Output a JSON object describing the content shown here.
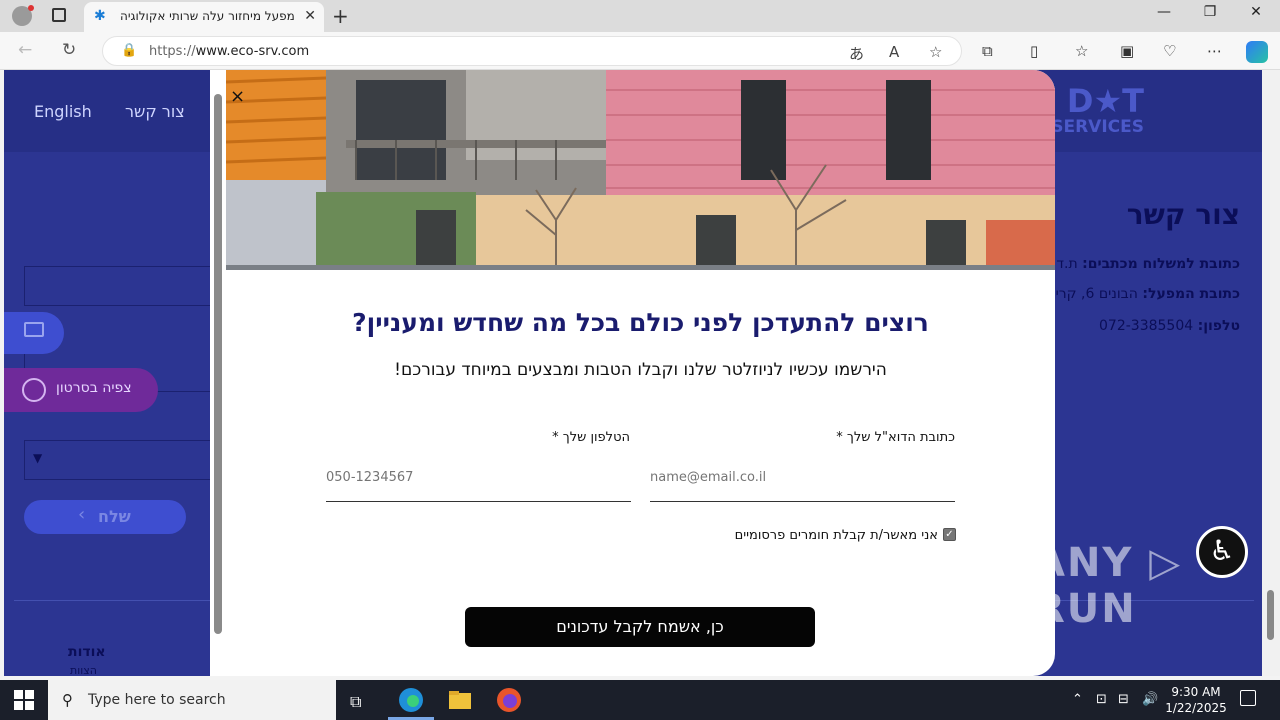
{
  "browser": {
    "tab_title": "מפעל מיחזור עלה שרותי אקולוגיה",
    "url_prefix": "https://",
    "url_host": "www.eco-srv.com",
    "minimize": "—",
    "restore": "❐",
    "close": "✕"
  },
  "site": {
    "nav_english": "English",
    "nav_contact": "צור קשר",
    "logo_top": "D★T",
    "logo_bottom": "SERVICES",
    "contact_title": "צור קשר",
    "contact_mail_label": "כתובת למשלוח מכתבים:",
    "contact_mail_value": " ת.ד",
    "contact_factory_label": "כתובת המפעל:",
    "contact_factory_value": " הבונים 6, קרי",
    "contact_phone_label": "טלפון:",
    "contact_phone_value": " 072-3385504",
    "side_video_label": "צפיה בסרטון",
    "send_label": "שלח",
    "footer_about": "אודות",
    "footer_about_sub": "הצוות"
  },
  "modal": {
    "close": "×",
    "title": "רוצים להתעדכן לפני כולם בכל מה שחדש ומעניין?",
    "subtitle": "הירשמו עכשיו לניוזלטר שלנו וקבלו הטבות ומבצעים במיוחד עבורכם!",
    "email_label": "כתובת הדוא\"ל שלך *",
    "email_placeholder": "name@email.co.il",
    "phone_label": "הטלפון שלך *",
    "phone_placeholder": "050-1234567",
    "consent_label": "אני מאשר/ת קבלת חומרים פרסומיים",
    "consent_checked": true,
    "submit_label": "כן, אשמח לקבל עדכונים"
  },
  "watermark": "ANY ▷ RUN",
  "taskbar": {
    "search_placeholder": "Type here to search",
    "time": "9:30 AM",
    "date": "1/22/2025"
  },
  "colors": {
    "page_bg": "#2c3592",
    "title_navy": "#1a1c6e",
    "submit_bg": "#050505"
  }
}
